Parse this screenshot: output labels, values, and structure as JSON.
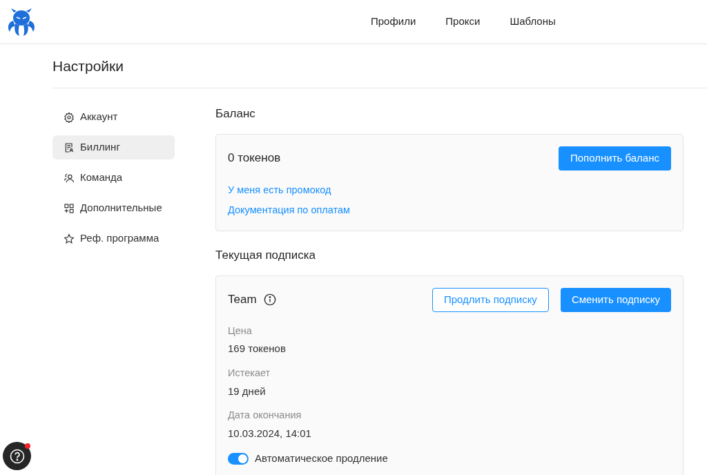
{
  "nav": [
    {
      "label": "Профили"
    },
    {
      "label": "Прокси"
    },
    {
      "label": "Шаблоны"
    }
  ],
  "page_title": "Настройки",
  "sidebar": {
    "items": [
      {
        "label": "Аккаунт",
        "selected": false
      },
      {
        "label": "Биллинг",
        "selected": true
      },
      {
        "label": "Команда",
        "selected": false
      },
      {
        "label": "Дополнительные",
        "selected": false
      },
      {
        "label": "Реф. программа",
        "selected": false
      }
    ]
  },
  "balance": {
    "heading": "Баланс",
    "amount": "0 токенов",
    "button": "Пополнить баланс",
    "links": [
      "У меня есть промокод",
      "Документация по оплатам"
    ]
  },
  "subscription": {
    "heading": "Текущая подписка",
    "plan": "Team",
    "buttons": [
      {
        "label": "Продлить подписку",
        "kind": "outline"
      },
      {
        "label": "Сменить подписку",
        "kind": "primary"
      }
    ],
    "fields": [
      {
        "label": "Цена",
        "value": "169 токенов"
      },
      {
        "label": "Истекает",
        "value": "19 дней"
      },
      {
        "label": "Дата окончания",
        "value": "10.03.2024, 14:01"
      }
    ],
    "auto_renew": {
      "label": "Автоматическое продление",
      "on": true
    }
  },
  "help": {
    "notification": true
  }
}
